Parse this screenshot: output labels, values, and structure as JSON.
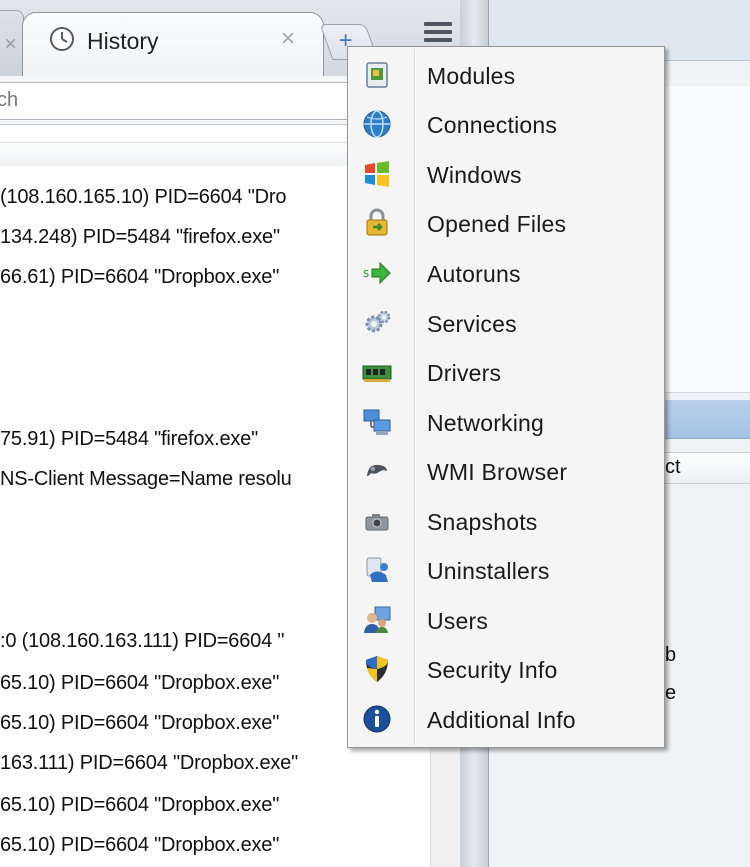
{
  "browser": {
    "tab_title": "History",
    "tab_close": "×",
    "new_tab": "+",
    "address_value": "ch"
  },
  "log_lines": [
    "(108.160.165.10) PID=6604 \"Dro",
    "134.248) PID=5484 \"firefox.exe\"",
    "66.61) PID=6604 \"Dropbox.exe\"",
    "75.91) PID=5484 \"firefox.exe\"",
    "NS-Client Message=Name resolu",
    ":0 (108.160.163.111) PID=6604 \"",
    "65.10) PID=6604 \"Dropbox.exe\"",
    "65.10) PID=6604 \"Dropbox.exe\"",
    "163.111) PID=6604 \"Dropbox.exe\"",
    "65.10) PID=6604 \"Dropbox.exe\"",
    "65.10) PID=6604 \"Dropbox.exe\""
  ],
  "right_panel": {
    "fragments": [
      "ct",
      "b",
      "e"
    ]
  },
  "menu": {
    "items": [
      {
        "label": "Modules",
        "icon": "modules-icon"
      },
      {
        "label": "Connections",
        "icon": "globe-icon"
      },
      {
        "label": "Windows",
        "icon": "windows-logo-icon"
      },
      {
        "label": "Opened Files",
        "icon": "locked-file-icon"
      },
      {
        "label": "Autoruns",
        "icon": "autorun-arrow-icon"
      },
      {
        "label": "Services",
        "icon": "gears-icon"
      },
      {
        "label": "Drivers",
        "icon": "circuit-board-icon"
      },
      {
        "label": "Networking",
        "icon": "network-computers-icon"
      },
      {
        "label": "WMI Browser",
        "icon": "wmi-icon"
      },
      {
        "label": "Snapshots",
        "icon": "camera-icon"
      },
      {
        "label": "Uninstallers",
        "icon": "uninstall-icon"
      },
      {
        "label": "Users",
        "icon": "users-icon"
      },
      {
        "label": "Security Info",
        "icon": "security-shield-icon"
      },
      {
        "label": "Additional Info",
        "icon": "info-icon"
      }
    ]
  },
  "colors": {
    "menu_background": "#f5f5f5",
    "menu_border": "#979797",
    "selected_row": "#a5c2e4"
  }
}
